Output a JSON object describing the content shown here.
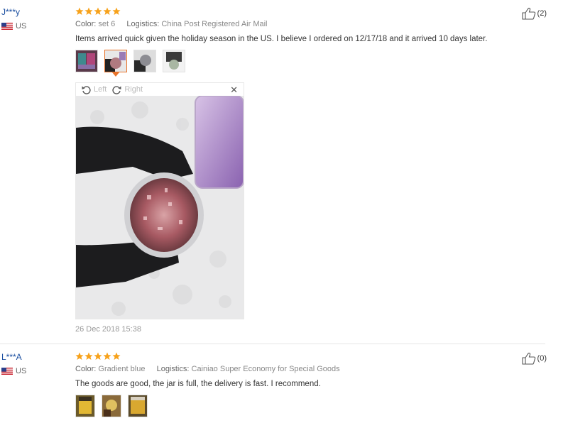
{
  "reviews": [
    {
      "user": "J***y",
      "country": "US",
      "rating": 5,
      "color_label": "Color:",
      "color_value": "set 6",
      "logistics_label": "Logistics:",
      "logistics_value": "China Post Registered Air Mail",
      "text": "Items arrived quick given the holiday season in the US. I believe I ordered on 12/17/18 and it arrived 10 days later.",
      "helpful_count": "(2)",
      "photos": 4,
      "active_photo": 2,
      "date": "26 Dec 2018 15:38"
    },
    {
      "user": "L***A",
      "country": "US",
      "rating": 5,
      "color_label": "Color:",
      "color_value": "Gradient blue",
      "logistics_label": "Logistics:",
      "logistics_value": "Cainiao Super Economy for Special Goods",
      "text": "The goods are good, the jar is full, the delivery is fast. I recommend.",
      "helpful_count": "(0)",
      "photos": 3
    }
  ],
  "viewer": {
    "rotate_left": "Left",
    "rotate_right": "Right",
    "close": "✕"
  },
  "colors": {
    "star": "#f7a21b",
    "username": "#1a4ea0",
    "active_thumb_border": "#e8732a"
  }
}
